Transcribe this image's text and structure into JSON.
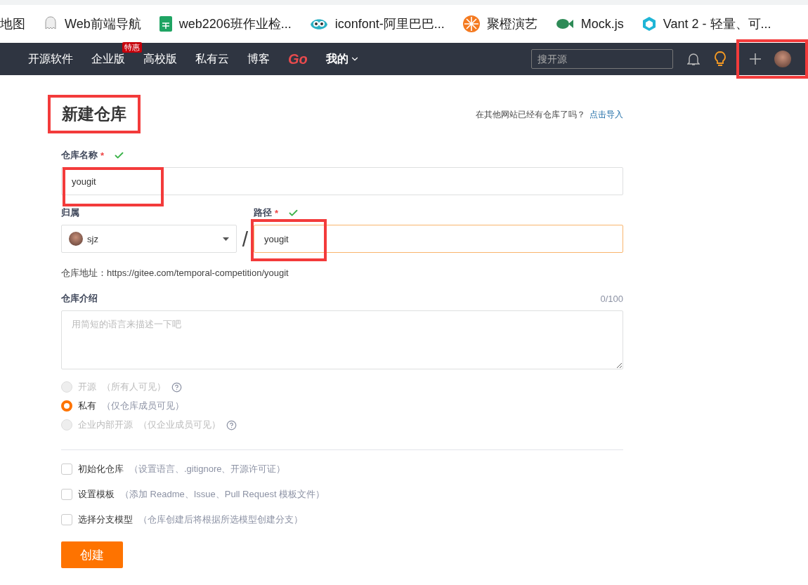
{
  "bookmarks": [
    {
      "label": "地图",
      "kind": "none"
    },
    {
      "label": "Web前端导航",
      "kind": "ghost"
    },
    {
      "label": "web2206班作业检...",
      "kind": "sheet"
    },
    {
      "label": "iconfont-阿里巴巴...",
      "kind": "eyes"
    },
    {
      "label": "聚橙演艺",
      "kind": "orange"
    },
    {
      "label": "Mock.js",
      "kind": "fish"
    },
    {
      "label": "Vant 2 - 轻量、可...",
      "kind": "cube"
    }
  ],
  "nav": {
    "items": [
      {
        "label": "开源软件",
        "kind": "link"
      },
      {
        "label": "企业版",
        "kind": "link",
        "badge": "特惠"
      },
      {
        "label": "高校版",
        "kind": "link"
      },
      {
        "label": "私有云",
        "kind": "link"
      },
      {
        "label": "博客",
        "kind": "link"
      },
      {
        "label": "Go",
        "kind": "logo"
      },
      {
        "label": "我的",
        "kind": "dropdown"
      }
    ],
    "search_placeholder": "搜开源",
    "actions_highlighted": true
  },
  "form": {
    "title": "新建仓库",
    "title_highlighted": true,
    "import_prompt": "在其他网站已经有仓库了吗？",
    "import_link": "点击导入",
    "name": {
      "label": "仓库名称",
      "required_mark": "*",
      "valid": true,
      "value": "yougit",
      "highlighted": true
    },
    "owner": {
      "label": "归属",
      "value": "sjz"
    },
    "separator": "/",
    "path": {
      "label": "路径",
      "required_mark": "*",
      "valid": true,
      "value": "yougit",
      "highlighted": true,
      "focused": true
    },
    "address": "仓库地址：https://gitee.com/temporal-competition/yougit",
    "description": {
      "label": "仓库介绍",
      "counter": "0/100",
      "placeholder": "用简短的语言来描述一下吧"
    },
    "visibility": [
      {
        "label": "开源",
        "note": "（所有人可见）",
        "selected": false,
        "disabled": true,
        "help": true
      },
      {
        "label": "私有",
        "note": "（仅仓库成员可见）",
        "selected": true,
        "disabled": false,
        "help": false
      },
      {
        "label": "企业内部开源",
        "note": "（仅企业成员可见）",
        "selected": false,
        "disabled": true,
        "help": true
      }
    ],
    "options": [
      {
        "label": "初始化仓库",
        "note": "（设置语言、.gitignore、开源许可证）",
        "checked": false
      },
      {
        "label": "设置模板",
        "note": "（添加 Readme、Issue、Pull Request 模板文件）",
        "checked": false
      },
      {
        "label": "选择分支模型",
        "note": "（仓库创建后将根据所选模型创建分支）",
        "checked": false
      }
    ],
    "submit": "创建"
  }
}
